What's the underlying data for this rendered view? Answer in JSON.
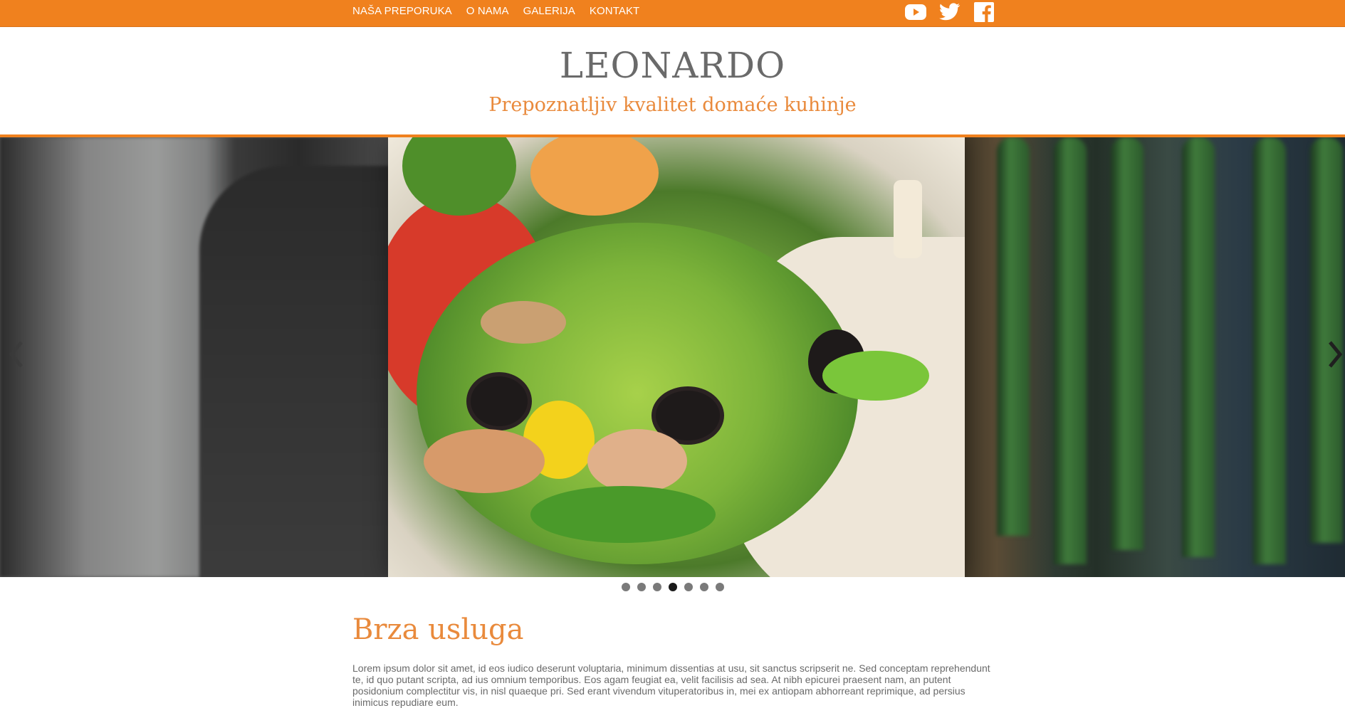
{
  "nav": {
    "items": [
      {
        "label": "NAŠA PREPORUKA"
      },
      {
        "label": "O NAMA"
      },
      {
        "label": "GALERIJA"
      },
      {
        "label": "KONTAKT"
      }
    ]
  },
  "social": {
    "icons": [
      "youtube-icon",
      "twitter-icon",
      "facebook-icon"
    ]
  },
  "header": {
    "brand": "LEONARDO",
    "tagline": "Prepoznatljiv kvalitet domaće kuhinje"
  },
  "slider": {
    "slide_count": 7,
    "active_index": 3
  },
  "section": {
    "title": "Brza usluga",
    "body": "Lorem ipsum dolor sit amet, id eos iudico deserunt voluptaria, minimum dissentias at usu, sit sanctus scripserit ne. Sed conceptam reprehendunt te, id quo putant scripta, ad ius omnium temporibus. Eos agam feugiat ea, velit facilisis ad sea. At nibh epicurei praesent nam, an putent posidonium complectitur vis, in nisl quaeque pri. Sed erant vivendum vituperatoribus in, mei ex antiopam abhorreant reprimique, ad persius inimicus repudiare eum."
  },
  "colors": {
    "accent": "#f0811e",
    "brand_text": "#6a6a6a",
    "tagline": "#e98a3c"
  }
}
